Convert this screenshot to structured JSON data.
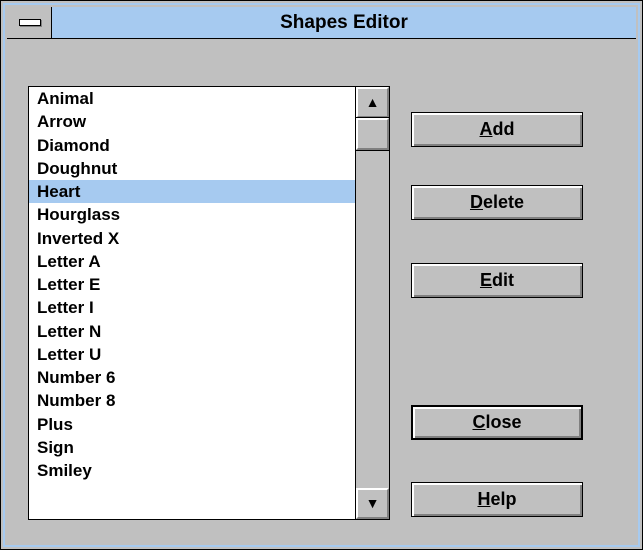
{
  "window": {
    "title": "Shapes Editor"
  },
  "list": {
    "items": [
      "Animal",
      "Arrow",
      "Diamond",
      "Doughnut",
      "Heart",
      "Hourglass",
      "Inverted X",
      "Letter A",
      "Letter E",
      "Letter I",
      "Letter N",
      "Letter U",
      "Number 6",
      "Number 8",
      "Plus",
      "Sign",
      "Smiley"
    ],
    "selected": "Heart"
  },
  "buttons": {
    "add": {
      "accel": "A",
      "rest": "dd"
    },
    "delete": {
      "accel": "D",
      "rest": "elete"
    },
    "edit": {
      "accel": "E",
      "rest": "dit"
    },
    "close": {
      "accel": "C",
      "rest": "lose"
    },
    "help": {
      "accel": "H",
      "rest": "elp"
    }
  },
  "icons": {
    "scroll_up": "▲",
    "scroll_down": "▼",
    "system_menu": "system-menu-icon"
  }
}
